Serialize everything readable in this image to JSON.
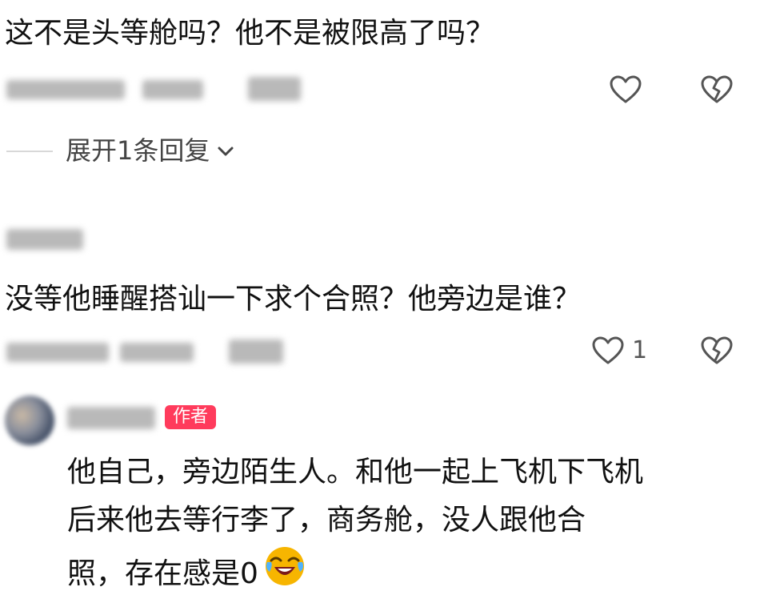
{
  "comments": [
    {
      "text": "这不是头等舱吗？他不是被限高了吗？",
      "like_count": "",
      "reply_toggle": "展开1条回复"
    },
    {
      "text": "没等他睡醒搭讪一下求个合照？他旁边是谁？",
      "like_count": "1"
    }
  ],
  "reply": {
    "badge": "作者",
    "lines": [
      "他自己，旁边陌生人。和他一起上飞机下飞机",
      "后来他去等行李了，商务舱，没人跟他合",
      "照，存在感是0"
    ],
    "emoji": "crying-laughing-emoji"
  },
  "colors": {
    "badge_bg": "#ff3b5c",
    "icon_stroke": "#555555",
    "emoji_yellow": "#f7b500"
  }
}
